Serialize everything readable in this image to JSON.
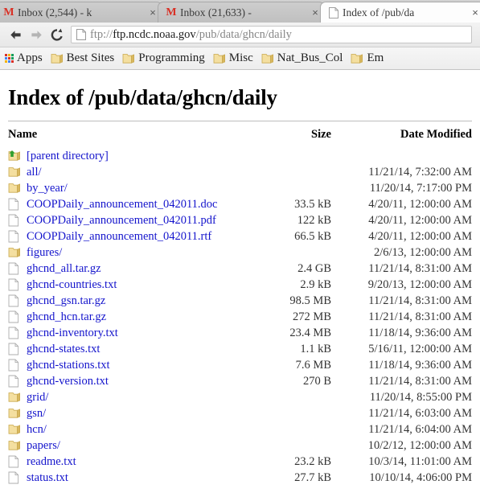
{
  "browser": {
    "tabs": [
      {
        "title": "Inbox (2,544) - k",
        "favicon": "gmail-icon",
        "active": false,
        "close_label": "×"
      },
      {
        "title": "Inbox (21,633) -",
        "favicon": "gmail-icon",
        "active": false,
        "close_label": "×"
      },
      {
        "title": "Index of /pub/da",
        "favicon": "page-icon",
        "active": true,
        "close_label": "×"
      }
    ],
    "toolbar": {
      "back_icon": "back-arrow-icon",
      "forward_icon": "forward-arrow-icon",
      "reload_icon": "reload-icon",
      "omnibox": {
        "scheme": "ftp://",
        "host": "ftp.ncdc.noaa.gov",
        "path": "/pub/data/ghcn/daily",
        "full_url": "ftp://ftp.ncdc.noaa.gov/pub/data/ghcn/daily",
        "page_icon": "document-icon"
      }
    },
    "bookmarks": [
      {
        "label": "Apps",
        "icon": "apps-grid-icon"
      },
      {
        "label": "Best Sites",
        "icon": "folder-icon"
      },
      {
        "label": "Programming",
        "icon": "folder-icon"
      },
      {
        "label": "Misc",
        "icon": "folder-icon"
      },
      {
        "label": "Nat_Bus_Col",
        "icon": "folder-icon"
      },
      {
        "label": "Em",
        "icon": "folder-icon"
      }
    ]
  },
  "page": {
    "title": "Index of /pub/data/ghcn/daily",
    "columns": {
      "name": "Name",
      "size": "Size",
      "date": "Date Modified"
    },
    "rows": [
      {
        "name": "[parent directory]",
        "icon": "up-folder-icon",
        "size": "",
        "date": ""
      },
      {
        "name": "all/",
        "icon": "folder-icon",
        "size": "",
        "date": "11/21/14, 7:32:00 AM"
      },
      {
        "name": "by_year/",
        "icon": "folder-icon",
        "size": "",
        "date": "11/20/14, 7:17:00 PM"
      },
      {
        "name": "COOPDaily_announcement_042011.doc",
        "icon": "file-icon",
        "size": "33.5 kB",
        "date": "4/20/11, 12:00:00 AM"
      },
      {
        "name": "COOPDaily_announcement_042011.pdf",
        "icon": "file-icon",
        "size": "122 kB",
        "date": "4/20/11, 12:00:00 AM"
      },
      {
        "name": "COOPDaily_announcement_042011.rtf",
        "icon": "file-icon",
        "size": "66.5 kB",
        "date": "4/20/11, 12:00:00 AM"
      },
      {
        "name": "figures/",
        "icon": "folder-icon",
        "size": "",
        "date": "2/6/13, 12:00:00 AM"
      },
      {
        "name": "ghcnd_all.tar.gz",
        "icon": "file-icon",
        "size": "2.4 GB",
        "date": "11/21/14, 8:31:00 AM"
      },
      {
        "name": "ghcnd-countries.txt",
        "icon": "file-icon",
        "size": "2.9 kB",
        "date": "9/20/13, 12:00:00 AM"
      },
      {
        "name": "ghcnd_gsn.tar.gz",
        "icon": "file-icon",
        "size": "98.5 MB",
        "date": "11/21/14, 8:31:00 AM"
      },
      {
        "name": "ghcnd_hcn.tar.gz",
        "icon": "file-icon",
        "size": "272 MB",
        "date": "11/21/14, 8:31:00 AM"
      },
      {
        "name": "ghcnd-inventory.txt",
        "icon": "file-icon",
        "size": "23.4 MB",
        "date": "11/18/14, 9:36:00 AM"
      },
      {
        "name": "ghcnd-states.txt",
        "icon": "file-icon",
        "size": "1.1 kB",
        "date": "5/16/11, 12:00:00 AM"
      },
      {
        "name": "ghcnd-stations.txt",
        "icon": "file-icon",
        "size": "7.6 MB",
        "date": "11/18/14, 9:36:00 AM"
      },
      {
        "name": "ghcnd-version.txt",
        "icon": "file-icon",
        "size": "270 B",
        "date": "11/21/14, 8:31:00 AM"
      },
      {
        "name": "grid/",
        "icon": "folder-icon",
        "size": "",
        "date": "11/20/14, 8:55:00 PM"
      },
      {
        "name": "gsn/",
        "icon": "folder-icon",
        "size": "",
        "date": "11/21/14, 6:03:00 AM"
      },
      {
        "name": "hcn/",
        "icon": "folder-icon",
        "size": "",
        "date": "11/21/14, 6:04:00 AM"
      },
      {
        "name": "papers/",
        "icon": "folder-icon",
        "size": "",
        "date": "10/2/12, 12:00:00 AM"
      },
      {
        "name": "readme.txt",
        "icon": "file-icon",
        "size": "23.2 kB",
        "date": "10/3/14, 11:01:00 AM"
      },
      {
        "name": "status.txt",
        "icon": "file-icon",
        "size": "27.7 kB",
        "date": "10/10/14, 4:06:00 PM"
      }
    ]
  },
  "colors": {
    "link": "#1414cc",
    "folder": "#f4dfa0",
    "folder_tab": "#d9b860",
    "text": "#333333",
    "gmail_red": "#d93025",
    "arrow_green": "#2f9e2f"
  }
}
